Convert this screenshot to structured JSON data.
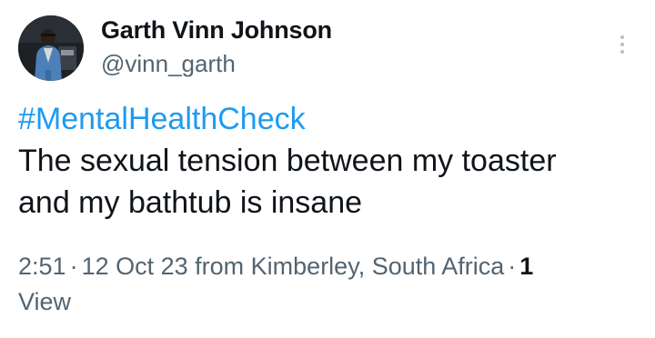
{
  "author": {
    "display_name": "Garth Vinn Johnson",
    "handle": "@vinn_garth",
    "avatar_icon": "profile-photo-avatar"
  },
  "tweet": {
    "hashtag": "#MentalHealthCheck",
    "text_line_1": "The sexual tension between my toaster",
    "text_line_2": "and my bathtub is insane"
  },
  "meta": {
    "time": "2:51",
    "separator": "·",
    "date": "12 Oct 23",
    "location": "from Kimberley, South Africa",
    "views_count": "1",
    "views_label": "View"
  },
  "icons": {
    "more": "more-vertical-icon"
  },
  "colors": {
    "link": "#1d9bf0",
    "primary_text": "#0f1419",
    "secondary_text": "#536471"
  }
}
